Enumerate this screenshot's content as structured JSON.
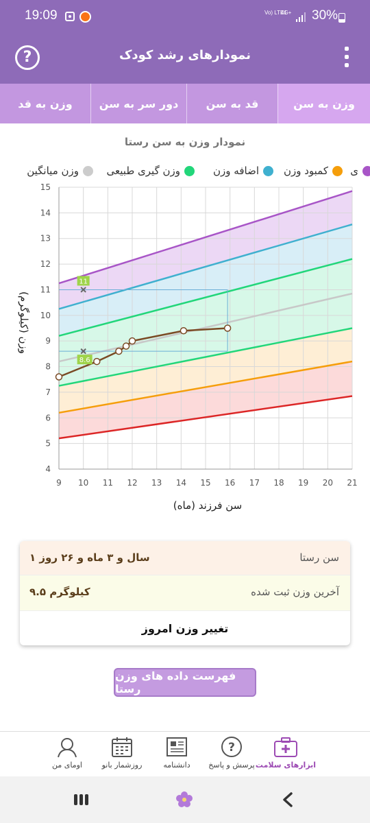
{
  "status_bar": {
    "time": "19:09",
    "network1": "Vo) LTE1",
    "network2": "4G+",
    "battery": "30%"
  },
  "header": {
    "title": "نمودارهای رشد کودک",
    "help_icon": "question-circle-icon",
    "menu_icon": "kebab-menu-icon"
  },
  "tabs": [
    {
      "label": "وزن به سن",
      "active": true
    },
    {
      "label": "قد به سن",
      "active": false
    },
    {
      "label": "دور سر به سن",
      "active": false
    },
    {
      "label": "وزن به قد",
      "active": false
    }
  ],
  "chart_title": "نمودار وزن به سن رستا",
  "legend": [
    {
      "label": "چاقی",
      "visible_text": "ی",
      "color": "#a855c7"
    },
    {
      "label": "کمبود وزن",
      "color": "#f59e0b"
    },
    {
      "label": "اضافه وزن",
      "color": "#3fb0cf"
    },
    {
      "label": "وزن گیری طبیعی",
      "color": "#22d67a"
    },
    {
      "label": "وزن میانگین",
      "color": "#cccccc"
    }
  ],
  "chart_data": {
    "type": "line",
    "xlabel": "سن فرزند (ماه)",
    "ylabel": "وزن (کیلوگرم)",
    "xlim": [
      9,
      21
    ],
    "ylim": [
      4,
      15
    ],
    "x_ticks": [
      "9",
      "10",
      "11",
      "12",
      "13",
      "14",
      "15",
      "16",
      "17",
      "18",
      "19",
      "20",
      "21"
    ],
    "y_ticks": [
      "4",
      "5",
      "6",
      "7",
      "8",
      "9",
      "10",
      "11",
      "12",
      "13",
      "14",
      "15"
    ],
    "reference_lines": [
      {
        "name": "obesity",
        "color": "#a855c7",
        "y_at_9": 11.25,
        "y_at_21": 14.85
      },
      {
        "name": "overweight",
        "color": "#3fb0cf",
        "y_at_9": 10.25,
        "y_at_21": 13.55
      },
      {
        "name": "normal_upper",
        "color": "#22d67a",
        "y_at_9": 9.2,
        "y_at_21": 12.2
      },
      {
        "name": "average",
        "color": "#c8c8c8",
        "y_at_9": 8.2,
        "y_at_21": 10.85
      },
      {
        "name": "normal_lower",
        "color": "#22d67a",
        "y_at_9": 7.25,
        "y_at_21": 9.5
      },
      {
        "name": "underweight",
        "color": "#f59e0b",
        "y_at_9": 6.2,
        "y_at_21": 8.2
      },
      {
        "name": "severe_underweight",
        "color": "#dc2626",
        "y_at_9": 5.2,
        "y_at_21": 6.85
      }
    ],
    "series": [
      {
        "color": "#7a4a24",
        "x": [
          9.0,
          10.55,
          11.45,
          11.75,
          12.0,
          14.1,
          15.9
        ],
        "y": [
          7.6,
          8.2,
          8.6,
          8.8,
          9.0,
          9.4,
          9.5
        ]
      }
    ],
    "markers": [
      {
        "x": 10,
        "y": 11,
        "label": "11"
      },
      {
        "x": 10,
        "y": 8.6,
        "label": "8.6"
      }
    ],
    "guides": {
      "x_end": 15.9,
      "y_top": 11,
      "y_bottom": 8.6
    }
  },
  "info": {
    "age_label": "سن رستا",
    "age_value": "۱ سال و ۳ ماه و ۲۶ روز",
    "weight_label": "آخرین وزن ثبت شده",
    "weight_value": "۹.۵ کیلوگرم",
    "change_button": "تغییر وزن امروز"
  },
  "list_button": "فهرست داده های وزن رستا",
  "bottom_nav": [
    {
      "label": "ابزارهای سلامت",
      "icon": "medical-kit-icon",
      "active": true
    },
    {
      "label": "پرسش و پاسخ",
      "icon": "question-bubble-icon",
      "active": false
    },
    {
      "label": "دانشنامه",
      "icon": "newspaper-icon",
      "active": false
    },
    {
      "label": "روزشمار بانو",
      "icon": "calendar-icon",
      "active": false
    },
    {
      "label": "اومای من",
      "icon": "profile-icon",
      "active": false
    }
  ],
  "system_nav": {
    "recents_icon": "recents-icon",
    "home_icon": "flower-home-icon",
    "back_icon": "back-chevron-icon"
  }
}
